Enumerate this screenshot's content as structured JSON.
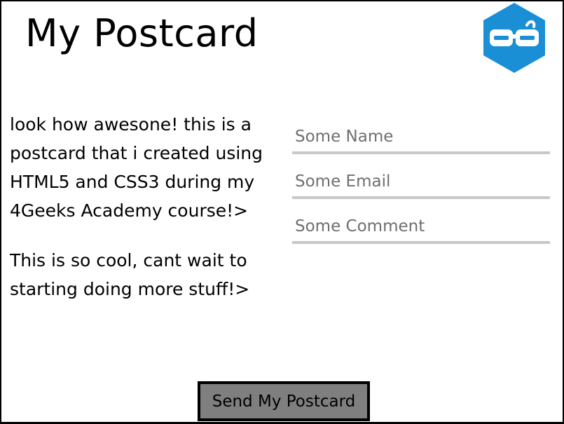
{
  "header": {
    "title": "My Postcard",
    "logo_icon": "4geeks-logo-icon",
    "logo_color": "#1a8fd6"
  },
  "message": {
    "paragraph_1": "look how awesone! this is a postcard that i created using HTML5 and CSS3 during my 4Geeks Academy course!>",
    "paragraph_2": "This is so cool, cant wait to starting doing more stuff!>"
  },
  "form": {
    "name": {
      "value": "",
      "placeholder": "Some Name"
    },
    "email": {
      "value": "",
      "placeholder": "Some Email"
    },
    "comment": {
      "value": "",
      "placeholder": "Some Comment"
    }
  },
  "actions": {
    "send_label": "Send My Postcard",
    "send_button_color": "#7f7f7f"
  }
}
